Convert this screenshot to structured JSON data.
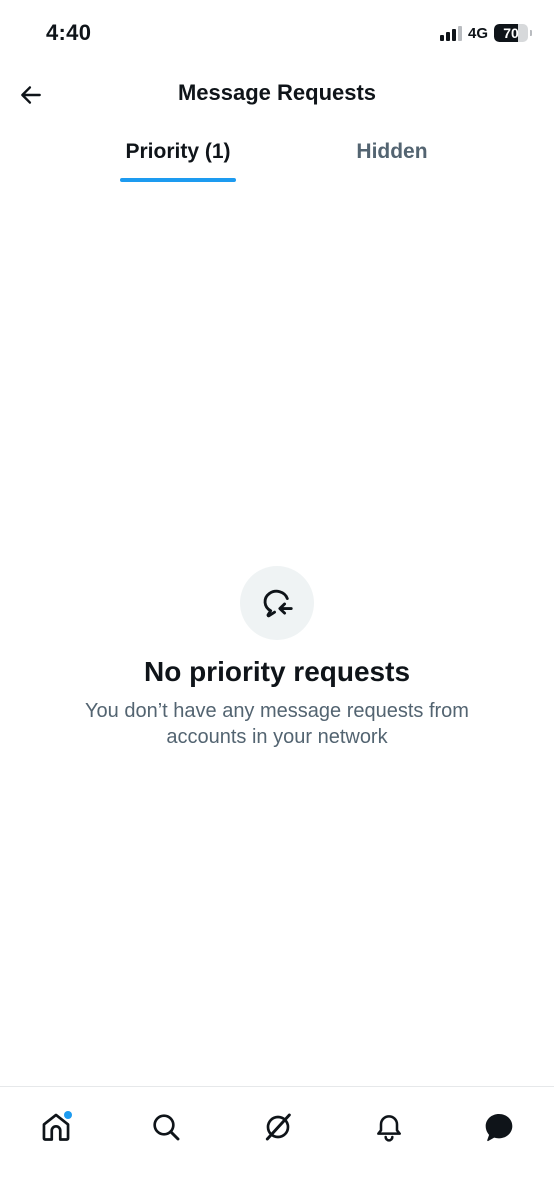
{
  "status_bar": {
    "time": "4:40",
    "network": "4G",
    "battery": "70",
    "battery_level": 0.7
  },
  "header": {
    "title": "Message Requests",
    "back_icon": "arrow-left-icon"
  },
  "tabs": [
    {
      "label": "Priority (1)",
      "active": true
    },
    {
      "label": "Hidden",
      "active": false
    }
  ],
  "empty_state": {
    "icon": "message-reply-icon",
    "title": "No priority requests",
    "description": "You don’t have any message requests from accounts in your network"
  },
  "bottom_nav": {
    "items": [
      {
        "name": "home",
        "icon": "home-icon",
        "has_dot": true
      },
      {
        "name": "search",
        "icon": "search-icon"
      },
      {
        "name": "grok",
        "icon": "grok-icon"
      },
      {
        "name": "notifications",
        "icon": "bell-icon"
      },
      {
        "name": "messages",
        "icon": "message-icon",
        "active": true
      }
    ]
  },
  "colors": {
    "accent": "#1d9bf0",
    "text_primary": "#0f1419",
    "text_secondary": "#536471",
    "icon_bg": "#eff3f4"
  }
}
